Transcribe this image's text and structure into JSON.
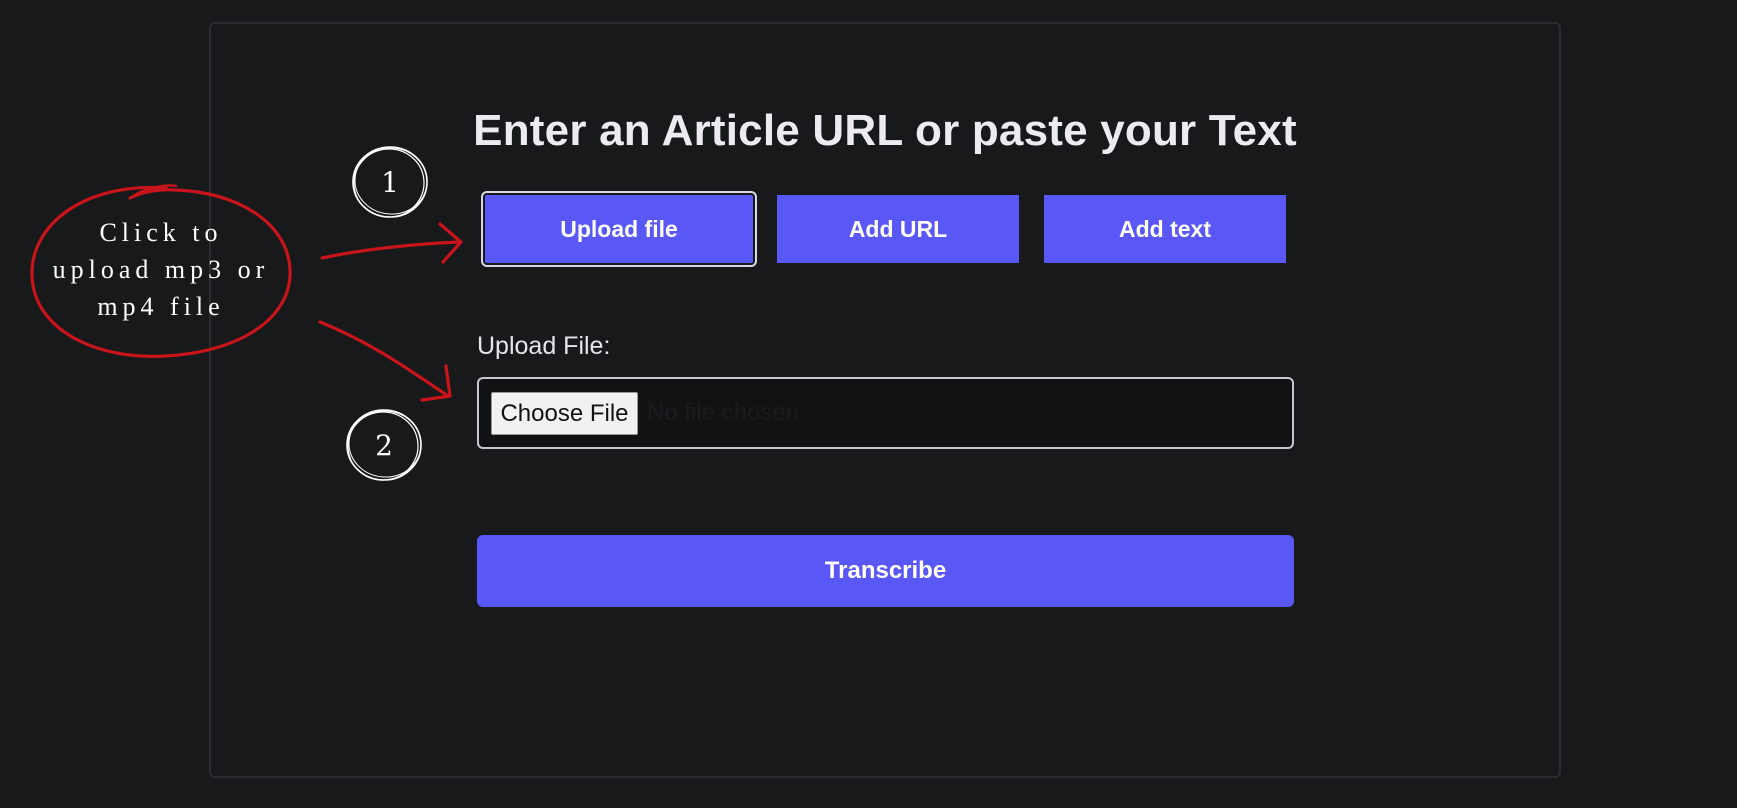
{
  "heading": "Enter an Article URL or paste your Text",
  "tabs": {
    "upload_file": "Upload file",
    "add_url": "Add URL",
    "add_text": "Add text"
  },
  "upload": {
    "label": "Upload File:",
    "choose_button": "Choose File",
    "status": "No file chosen"
  },
  "submit_label": "Transcribe",
  "annotations": {
    "step_1": "1",
    "step_2": "2",
    "callout_lines": [
      "Click to",
      "upload mp3 or",
      "mp4 file"
    ]
  },
  "colors": {
    "background": "#18191b",
    "accent": "#5a57f7",
    "annotation_red": "#c8141a"
  }
}
